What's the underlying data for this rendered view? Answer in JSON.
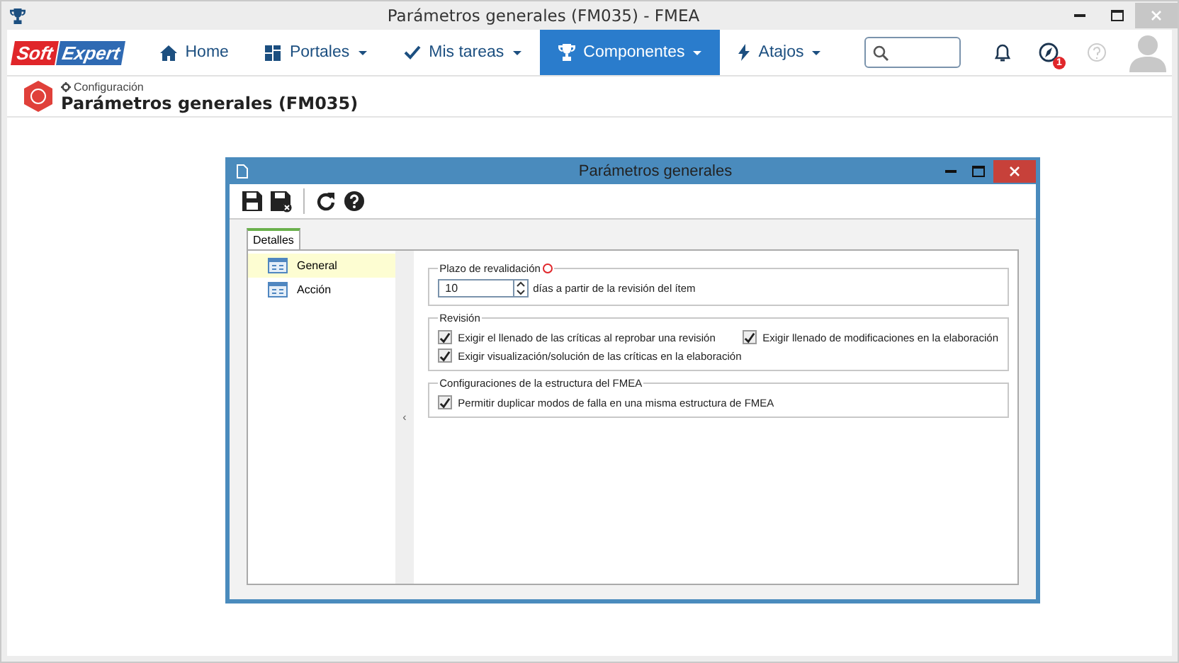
{
  "window": {
    "title": "Parámetros generales (FM035) - FMEA"
  },
  "logo": {
    "part_1": "Soft",
    "part_2": "Expert"
  },
  "nav": [
    {
      "label": "Home",
      "dropdown": false,
      "selected": false
    },
    {
      "label": "Portales",
      "dropdown": true,
      "selected": false
    },
    {
      "label": "Mis tareas",
      "dropdown": true,
      "selected": false
    },
    {
      "label": "Componentes",
      "dropdown": true,
      "selected": true
    },
    {
      "label": "Atajos",
      "dropdown": true,
      "selected": false
    }
  ],
  "notifications_badge": "1",
  "header": {
    "breadcrumb": "Configuración",
    "title": "Parámetros generales (FM035)"
  },
  "dialog": {
    "title": "Parámetros generales",
    "tab": "Detalles",
    "collapse_arrow": "‹",
    "sidebar": [
      {
        "label": "General",
        "selected": true
      },
      {
        "label": "Acción",
        "selected": false
      }
    ],
    "revalidation": {
      "legend": "Plazo de revalidación",
      "value": "10",
      "suffix": "días a partir de la revisión del ítem"
    },
    "revision": {
      "legend": "Revisión",
      "options": [
        {
          "label": "Exigir el llenado de las críticas al reprobar una revisión",
          "checked": true
        },
        {
          "label": "Exigir llenado de modificaciones en la elaboración",
          "checked": true
        },
        {
          "label": "Exigir visualización/solución de las críticas en la elaboración",
          "checked": true
        }
      ]
    },
    "structure": {
      "legend": "Configuraciones de la estructura del FMEA",
      "options": [
        {
          "label": "Permitir duplicar modos de falla en una misma estructura de FMEA",
          "checked": true
        }
      ]
    }
  }
}
